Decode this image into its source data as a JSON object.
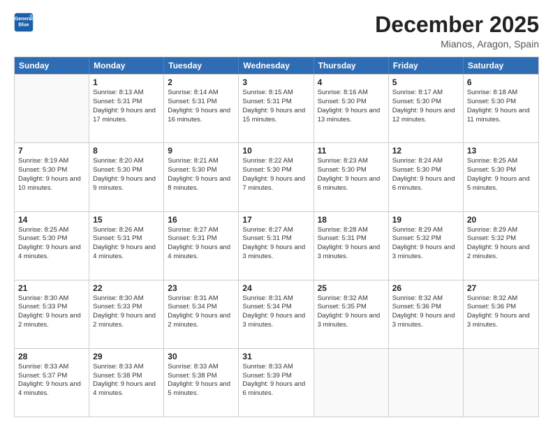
{
  "header": {
    "logo_line1": "General",
    "logo_line2": "Blue",
    "month": "December 2025",
    "location": "Mianos, Aragon, Spain"
  },
  "weekdays": [
    "Sunday",
    "Monday",
    "Tuesday",
    "Wednesday",
    "Thursday",
    "Friday",
    "Saturday"
  ],
  "rows": [
    [
      {
        "day": "",
        "info": ""
      },
      {
        "day": "1",
        "info": "Sunrise: 8:13 AM\nSunset: 5:31 PM\nDaylight: 9 hours\nand 17 minutes."
      },
      {
        "day": "2",
        "info": "Sunrise: 8:14 AM\nSunset: 5:31 PM\nDaylight: 9 hours\nand 16 minutes."
      },
      {
        "day": "3",
        "info": "Sunrise: 8:15 AM\nSunset: 5:31 PM\nDaylight: 9 hours\nand 15 minutes."
      },
      {
        "day": "4",
        "info": "Sunrise: 8:16 AM\nSunset: 5:30 PM\nDaylight: 9 hours\nand 13 minutes."
      },
      {
        "day": "5",
        "info": "Sunrise: 8:17 AM\nSunset: 5:30 PM\nDaylight: 9 hours\nand 12 minutes."
      },
      {
        "day": "6",
        "info": "Sunrise: 8:18 AM\nSunset: 5:30 PM\nDaylight: 9 hours\nand 11 minutes."
      }
    ],
    [
      {
        "day": "7",
        "info": "Sunrise: 8:19 AM\nSunset: 5:30 PM\nDaylight: 9 hours\nand 10 minutes."
      },
      {
        "day": "8",
        "info": "Sunrise: 8:20 AM\nSunset: 5:30 PM\nDaylight: 9 hours\nand 9 minutes."
      },
      {
        "day": "9",
        "info": "Sunrise: 8:21 AM\nSunset: 5:30 PM\nDaylight: 9 hours\nand 8 minutes."
      },
      {
        "day": "10",
        "info": "Sunrise: 8:22 AM\nSunset: 5:30 PM\nDaylight: 9 hours\nand 7 minutes."
      },
      {
        "day": "11",
        "info": "Sunrise: 8:23 AM\nSunset: 5:30 PM\nDaylight: 9 hours\nand 6 minutes."
      },
      {
        "day": "12",
        "info": "Sunrise: 8:24 AM\nSunset: 5:30 PM\nDaylight: 9 hours\nand 6 minutes."
      },
      {
        "day": "13",
        "info": "Sunrise: 8:25 AM\nSunset: 5:30 PM\nDaylight: 9 hours\nand 5 minutes."
      }
    ],
    [
      {
        "day": "14",
        "info": "Sunrise: 8:25 AM\nSunset: 5:30 PM\nDaylight: 9 hours\nand 4 minutes."
      },
      {
        "day": "15",
        "info": "Sunrise: 8:26 AM\nSunset: 5:31 PM\nDaylight: 9 hours\nand 4 minutes."
      },
      {
        "day": "16",
        "info": "Sunrise: 8:27 AM\nSunset: 5:31 PM\nDaylight: 9 hours\nand 4 minutes."
      },
      {
        "day": "17",
        "info": "Sunrise: 8:27 AM\nSunset: 5:31 PM\nDaylight: 9 hours\nand 3 minutes."
      },
      {
        "day": "18",
        "info": "Sunrise: 8:28 AM\nSunset: 5:31 PM\nDaylight: 9 hours\nand 3 minutes."
      },
      {
        "day": "19",
        "info": "Sunrise: 8:29 AM\nSunset: 5:32 PM\nDaylight: 9 hours\nand 3 minutes."
      },
      {
        "day": "20",
        "info": "Sunrise: 8:29 AM\nSunset: 5:32 PM\nDaylight: 9 hours\nand 2 minutes."
      }
    ],
    [
      {
        "day": "21",
        "info": "Sunrise: 8:30 AM\nSunset: 5:33 PM\nDaylight: 9 hours\nand 2 minutes."
      },
      {
        "day": "22",
        "info": "Sunrise: 8:30 AM\nSunset: 5:33 PM\nDaylight: 9 hours\nand 2 minutes."
      },
      {
        "day": "23",
        "info": "Sunrise: 8:31 AM\nSunset: 5:34 PM\nDaylight: 9 hours\nand 2 minutes."
      },
      {
        "day": "24",
        "info": "Sunrise: 8:31 AM\nSunset: 5:34 PM\nDaylight: 9 hours\nand 3 minutes."
      },
      {
        "day": "25",
        "info": "Sunrise: 8:32 AM\nSunset: 5:35 PM\nDaylight: 9 hours\nand 3 minutes."
      },
      {
        "day": "26",
        "info": "Sunrise: 8:32 AM\nSunset: 5:36 PM\nDaylight: 9 hours\nand 3 minutes."
      },
      {
        "day": "27",
        "info": "Sunrise: 8:32 AM\nSunset: 5:36 PM\nDaylight: 9 hours\nand 3 minutes."
      }
    ],
    [
      {
        "day": "28",
        "info": "Sunrise: 8:33 AM\nSunset: 5:37 PM\nDaylight: 9 hours\nand 4 minutes."
      },
      {
        "day": "29",
        "info": "Sunrise: 8:33 AM\nSunset: 5:38 PM\nDaylight: 9 hours\nand 4 minutes."
      },
      {
        "day": "30",
        "info": "Sunrise: 8:33 AM\nSunset: 5:38 PM\nDaylight: 9 hours\nand 5 minutes."
      },
      {
        "day": "31",
        "info": "Sunrise: 8:33 AM\nSunset: 5:39 PM\nDaylight: 9 hours\nand 6 minutes."
      },
      {
        "day": "",
        "info": ""
      },
      {
        "day": "",
        "info": ""
      },
      {
        "day": "",
        "info": ""
      }
    ]
  ]
}
